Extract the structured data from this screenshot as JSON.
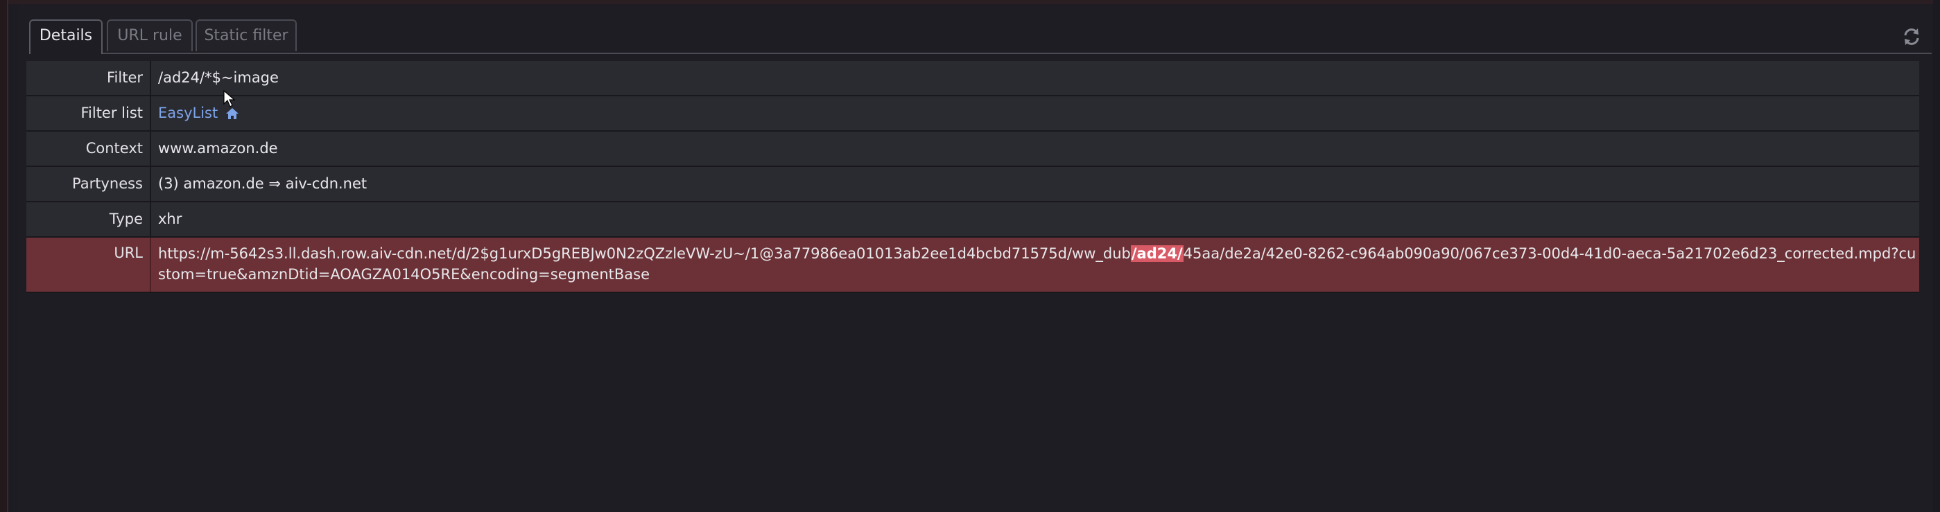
{
  "tabs": [
    {
      "label": "Details",
      "active": true
    },
    {
      "label": "URL rule",
      "active": false
    },
    {
      "label": "Static filter",
      "active": false
    }
  ],
  "details": {
    "filter_label": "Filter",
    "filter_value": "/ad24/*$~image",
    "filter_list_label": "Filter list",
    "filter_list_value": "EasyList",
    "context_label": "Context",
    "context_value": "www.amazon.de",
    "partyness_label": "Partyness",
    "partyness_value": "(3)  amazon.de ⇒ aiv-cdn.net",
    "type_label": "Type",
    "type_value": "xhr",
    "url_label": "URL",
    "url_before": "https://m-5642s3.ll.dash.row.aiv-cdn.net/d/2$g1urxD5gREBJw0N2zQZzleVW-zU~/1@3a77986ea01013ab2ee1d4bcbd71575d/ww_dub",
    "url_match": "/ad24/",
    "url_after": "45aa/de2a/42e0-8262-c964ab090a90/067ce373-00d4-41d0-aeca-5a21702e6d23_corrected.mpd?custom=true&amznDtid=AOAGZA014O5RE&encoding=segmentBase"
  },
  "colors": {
    "background": "#1d1d23",
    "row_bg": "#2a2a31",
    "url_row_bg": "#6b3136",
    "highlight": "#d85a66",
    "link": "#7da4e8"
  },
  "icons": {
    "refresh": "refresh-icon",
    "home": "home-icon",
    "cursor": "mouse-cursor-icon"
  }
}
